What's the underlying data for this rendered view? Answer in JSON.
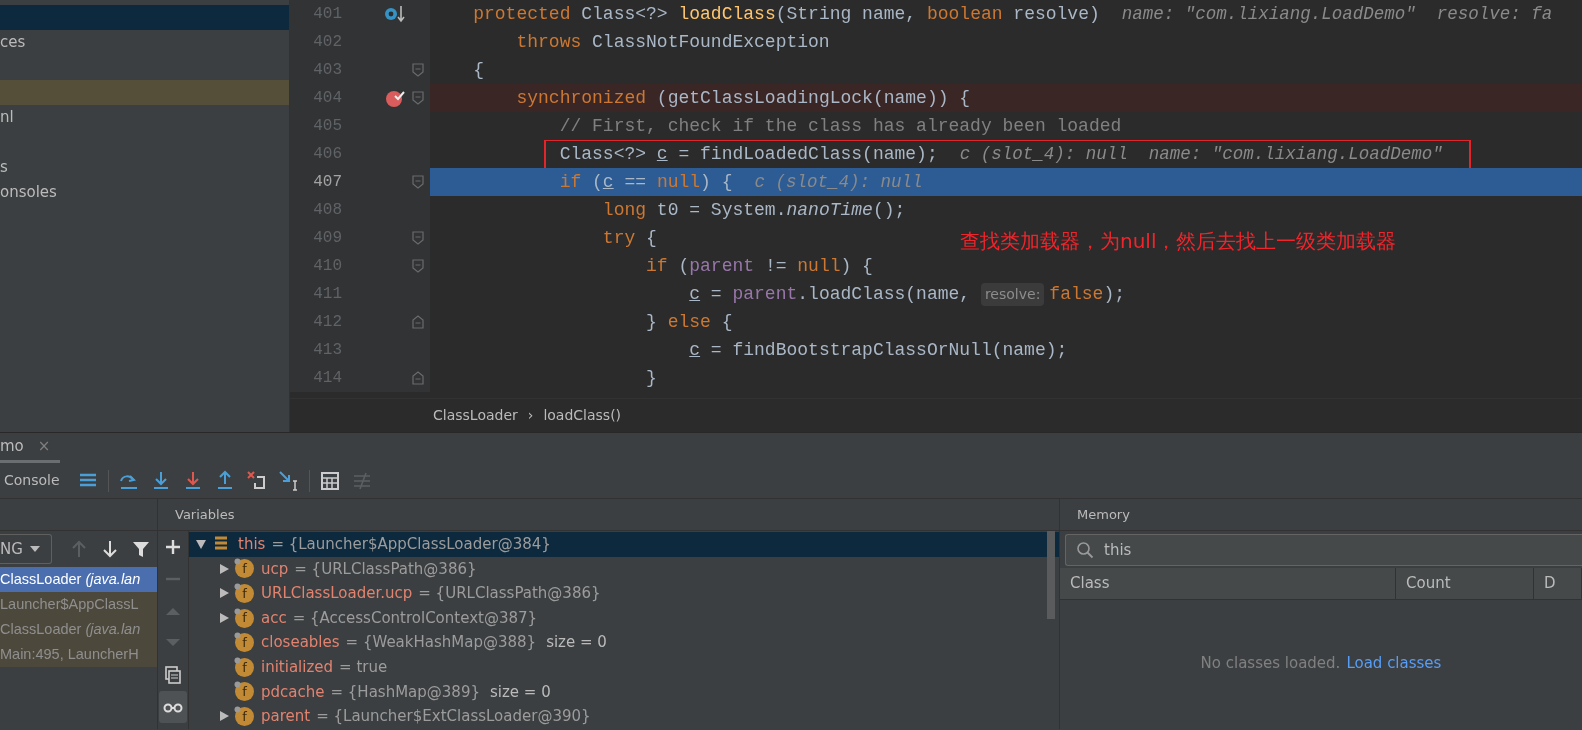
{
  "project_panel": {
    "items": [
      {
        "selected": true,
        "highlighted": false
      },
      {
        "label": "ces",
        "selected": false,
        "highlighted": false
      },
      {
        "selected": false,
        "highlighted": false
      },
      {
        "selected": false,
        "highlighted": true
      },
      {
        "label": "nl",
        "selected": false,
        "highlighted": false
      },
      {
        "selected": false,
        "highlighted": false
      },
      {
        "label": "s",
        "selected": false,
        "highlighted": false
      },
      {
        "label": "onsoles",
        "selected": false,
        "highlighted": false
      }
    ]
  },
  "editor": {
    "lines": [
      {
        "number": "401",
        "override_marker": true,
        "breakpoint": false,
        "fold_start": false,
        "fold_end": false,
        "current": false,
        "boxed": false,
        "segments": [
          {
            "kind": "code",
            "tokens": [
              {
                "kind": "keyword",
                "text": "    protected"
              },
              {
                "kind": "plain",
                "text": " Class<?> "
              },
              {
                "kind": "method",
                "text": "loadClass"
              },
              {
                "kind": "plain",
                "text": "(String name, "
              },
              {
                "kind": "keyword",
                "text": "boolean"
              },
              {
                "kind": "plain",
                "text": " resolve)"
              }
            ]
          },
          {
            "kind": "hint",
            "text": "name: \"com.lixiang.LoadDemo\"  resolve: fa"
          }
        ]
      },
      {
        "number": "402",
        "override_marker": false,
        "breakpoint": false,
        "fold_start": false,
        "fold_end": false,
        "current": false,
        "boxed": false,
        "segments": [
          {
            "kind": "code",
            "tokens": [
              {
                "kind": "keyword",
                "text": "        throws"
              },
              {
                "kind": "plain",
                "text": " ClassNotFoundException"
              }
            ]
          }
        ]
      },
      {
        "number": "403",
        "override_marker": false,
        "breakpoint": false,
        "fold_start": true,
        "fold_end": false,
        "current": false,
        "boxed": false,
        "segments": [
          {
            "kind": "code",
            "tokens": [
              {
                "kind": "plain",
                "text": "    {"
              }
            ]
          }
        ]
      },
      {
        "number": "404",
        "override_marker": false,
        "breakpoint": true,
        "fold_start": true,
        "fold_end": false,
        "current": false,
        "boxed": false,
        "segments": [
          {
            "kind": "code",
            "tokens": [
              {
                "kind": "keyword",
                "text": "        synchronized"
              },
              {
                "kind": "plain",
                "text": " (getClassLoadingLock(name)) {"
              }
            ]
          }
        ]
      },
      {
        "number": "405",
        "override_marker": false,
        "breakpoint": false,
        "fold_start": false,
        "fold_end": false,
        "current": false,
        "boxed": false,
        "segments": [
          {
            "kind": "code",
            "tokens": [
              {
                "kind": "comment",
                "text": "            // First, check if the class has already been loaded"
              }
            ]
          }
        ]
      },
      {
        "number": "406",
        "override_marker": false,
        "breakpoint": false,
        "fold_start": false,
        "fold_end": false,
        "current": false,
        "boxed": true,
        "segments": [
          {
            "kind": "code",
            "tokens": [
              {
                "kind": "plain",
                "text": "            Class<?> "
              },
              {
                "kind": "underline",
                "text": "c"
              },
              {
                "kind": "plain",
                "text": " = findLoadedClass(name);"
              }
            ]
          },
          {
            "kind": "hint",
            "text": "c (slot_4): null  name: \"com.lixiang.LoadDemo\""
          }
        ]
      },
      {
        "number": "407",
        "override_marker": false,
        "breakpoint": false,
        "fold_start": true,
        "fold_end": false,
        "current": true,
        "boxed": false,
        "segments": [
          {
            "kind": "code",
            "tokens": [
              {
                "kind": "keyword",
                "text": "            if"
              },
              {
                "kind": "plain",
                "text": " ("
              },
              {
                "kind": "underline",
                "text": "c"
              },
              {
                "kind": "plain",
                "text": " == "
              },
              {
                "kind": "keyword",
                "text": "null"
              },
              {
                "kind": "plain",
                "text": ") {"
              }
            ]
          },
          {
            "kind": "hint",
            "text": "c (slot_4): null"
          }
        ]
      },
      {
        "number": "408",
        "override_marker": false,
        "breakpoint": false,
        "fold_start": false,
        "fold_end": false,
        "current": false,
        "boxed": false,
        "segments": [
          {
            "kind": "code",
            "tokens": [
              {
                "kind": "keyword",
                "text": "                long"
              },
              {
                "kind": "plain",
                "text": " t0 = System."
              },
              {
                "kind": "italic",
                "text": "nanoTime"
              },
              {
                "kind": "plain",
                "text": "();"
              }
            ]
          }
        ]
      },
      {
        "number": "409",
        "override_marker": false,
        "breakpoint": false,
        "fold_start": true,
        "fold_end": false,
        "current": false,
        "boxed": false,
        "segments": [
          {
            "kind": "code",
            "tokens": [
              {
                "kind": "keyword",
                "text": "                try"
              },
              {
                "kind": "plain",
                "text": " {"
              }
            ]
          }
        ]
      },
      {
        "number": "410",
        "override_marker": false,
        "breakpoint": false,
        "fold_start": true,
        "fold_end": false,
        "current": false,
        "boxed": false,
        "segments": [
          {
            "kind": "code",
            "tokens": [
              {
                "kind": "keyword",
                "text": "                    if"
              },
              {
                "kind": "plain",
                "text": " ("
              },
              {
                "kind": "field",
                "text": "parent"
              },
              {
                "kind": "plain",
                "text": " != "
              },
              {
                "kind": "keyword",
                "text": "null"
              },
              {
                "kind": "plain",
                "text": ") {"
              }
            ]
          }
        ]
      },
      {
        "number": "411",
        "override_marker": false,
        "breakpoint": false,
        "fold_start": false,
        "fold_end": false,
        "current": false,
        "boxed": false,
        "segments": [
          {
            "kind": "code",
            "tokens": [
              {
                "kind": "underline",
                "text": "                        c"
              },
              {
                "kind": "plain",
                "text": " = "
              },
              {
                "kind": "field",
                "text": "parent"
              },
              {
                "kind": "plain",
                "text": ".loadClass(name, "
              }
            ]
          },
          {
            "kind": "param_hint",
            "text": "resolve:"
          },
          {
            "kind": "code",
            "tokens": [
              {
                "kind": "keyword",
                "text": "false"
              },
              {
                "kind": "plain",
                "text": ");"
              }
            ]
          }
        ]
      },
      {
        "number": "412",
        "override_marker": false,
        "breakpoint": false,
        "fold_start": false,
        "fold_end": true,
        "current": false,
        "boxed": false,
        "segments": [
          {
            "kind": "code",
            "tokens": [
              {
                "kind": "plain",
                "text": "                    } "
              },
              {
                "kind": "keyword",
                "text": "else"
              },
              {
                "kind": "plain",
                "text": " {"
              }
            ]
          }
        ]
      },
      {
        "number": "413",
        "override_marker": false,
        "breakpoint": false,
        "fold_start": false,
        "fold_end": false,
        "current": false,
        "boxed": false,
        "segments": [
          {
            "kind": "code",
            "tokens": [
              {
                "kind": "underline",
                "text": "                        c"
              },
              {
                "kind": "plain",
                "text": " = findBootstrapClassOrNull(name);"
              }
            ]
          }
        ]
      },
      {
        "number": "414",
        "override_marker": false,
        "breakpoint": false,
        "fold_start": false,
        "fold_end": true,
        "current": false,
        "boxed": false,
        "segments": [
          {
            "kind": "code",
            "tokens": [
              {
                "kind": "plain",
                "text": "                    }"
              }
            ]
          }
        ]
      }
    ],
    "annotation": "查找类加载器，为null，然后去找上一级类加载器",
    "breadcrumbs": [
      "ClassLoader",
      "loadClass()"
    ],
    "breadcrumb_separator": "›"
  },
  "debug": {
    "tab": {
      "label": "mo",
      "close": "×",
      "selected": true
    },
    "toolbar": {
      "label": "Console",
      "tools": [
        {
          "disabled": false
        },
        {
          "disabled": false
        },
        {
          "disabled": false
        },
        {
          "disabled": false
        },
        {
          "disabled": false
        },
        {
          "disabled": false
        },
        {
          "disabled": false
        },
        {
          "disabled": false
        },
        {
          "disabled": true
        }
      ]
    },
    "frames": {
      "thread": "NG",
      "tools": [
        {
          "disabled": true
        },
        {
          "disabled": false
        },
        {
          "disabled": false
        }
      ],
      "items": [
        {
          "text": "ClassLoader *(java.lan*",
          "selected": true,
          "library": false
        },
        {
          "text": "Launcher$AppClassL",
          "selected": false,
          "library": true
        },
        {
          "text": "ClassLoader *(java.lan*",
          "selected": false,
          "library": true
        },
        {
          "text": "Main:495, LauncherH",
          "selected": false,
          "library": true
        }
      ]
    },
    "variables": {
      "title": "Variables",
      "tools": [
        {
          "disabled": false,
          "selected": false
        },
        {
          "disabled": true,
          "selected": false
        },
        {
          "disabled": true,
          "selected": false
        },
        {
          "disabled": true,
          "selected": false
        },
        {
          "disabled": false,
          "selected": false
        },
        {
          "disabled": false,
          "selected": true
        }
      ],
      "items": [
        {
          "kind": "object",
          "name": "this",
          "value": "= {Launcher$AppClassLoader@384}",
          "expandable": true,
          "expanded": true,
          "selected": true,
          "children": [
            {
              "kind": "field",
              "letter": "f",
              "name": "ucp",
              "value": "= {URLClassPath@386}",
              "expandable": true,
              "expanded": false,
              "selected": false
            },
            {
              "kind": "field",
              "letter": "f",
              "name": "URLClassLoader.ucp",
              "value": "= {URLClassPath@386}",
              "expandable": true,
              "expanded": false,
              "selected": false
            },
            {
              "kind": "field",
              "letter": "f",
              "name": "acc",
              "value": "= {AccessControlContext@387}",
              "expandable": true,
              "expanded": false,
              "selected": false
            },
            {
              "kind": "field",
              "letter": "f",
              "name": "closeables",
              "value": "= {WeakHashMap@388}",
              "extra": "size = 0",
              "expandable": false,
              "selected": false
            },
            {
              "kind": "field",
              "letter": "f",
              "name": "initialized",
              "value": "= true",
              "expandable": false,
              "selected": false
            },
            {
              "kind": "field",
              "letter": "f",
              "name": "pdcache",
              "value": "= {HashMap@389}",
              "extra": "size = 0",
              "expandable": false,
              "selected": false
            },
            {
              "kind": "field",
              "letter": "f",
              "name": "parent",
              "value": "= {Launcher$ExtClassLoader@390}",
              "expandable": true,
              "expanded": false,
              "selected": false
            }
          ]
        }
      ]
    },
    "memory": {
      "title": "Memory",
      "search": {
        "value": "this"
      },
      "columns": [
        "Class",
        "Count",
        "D"
      ],
      "empty_text": "No classes loaded.",
      "empty_link": "Load classes"
    }
  }
}
